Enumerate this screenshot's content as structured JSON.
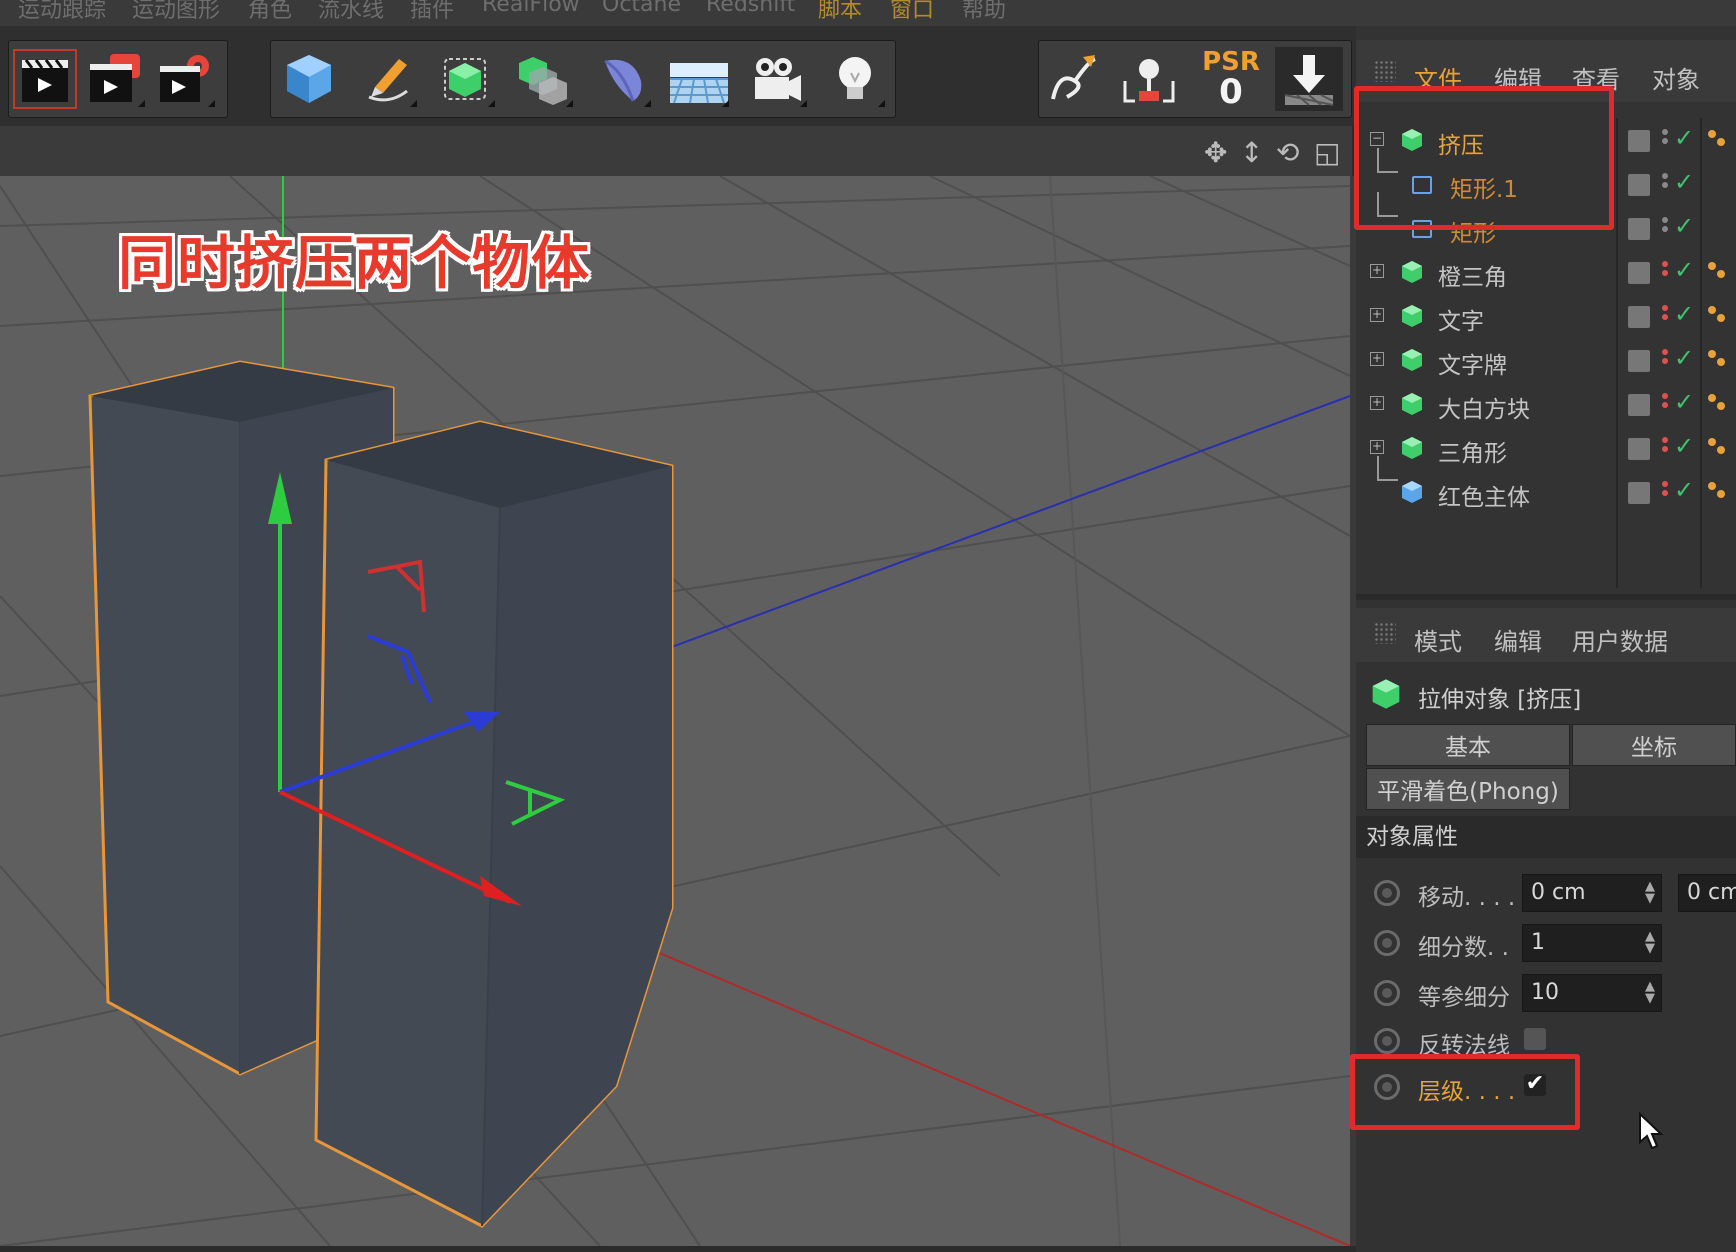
{
  "menubar": {
    "items": [
      {
        "label": "运动跟踪",
        "highlight": false
      },
      {
        "label": "运动图形",
        "highlight": false
      },
      {
        "label": "角色",
        "highlight": false
      },
      {
        "label": "流水线",
        "highlight": false
      },
      {
        "label": "插件",
        "highlight": false
      },
      {
        "label": "RealFlow",
        "highlight": false
      },
      {
        "label": "Octane",
        "highlight": false
      },
      {
        "label": "Redshift",
        "highlight": false
      },
      {
        "label": "脚本",
        "highlight": true
      },
      {
        "label": "窗口",
        "highlight": true
      },
      {
        "label": "帮助",
        "highlight": false
      }
    ]
  },
  "toolbar": {
    "render_group": [
      "render-view-icon",
      "render-picture-viewer-icon",
      "render-settings-icon"
    ],
    "create_group": [
      "cube-icon",
      "pen-icon",
      "subdivision-surface-icon",
      "array-icon",
      "deformer-icon",
      "floor-icon",
      "camera-icon",
      "light-icon"
    ],
    "right_group": {
      "psr_label": "PSR",
      "psr_value": "0"
    }
  },
  "viewport": {
    "overlay_title": "同时挤压两个物体",
    "colors": {
      "background": "#5f5f5f",
      "grid": "#4e4e4e",
      "object_fill": "#454c56",
      "selection_outline": "#e8963a",
      "axis_x": "#e02020",
      "axis_y": "#2ecc40",
      "axis_z": "#2a3bd6"
    }
  },
  "object_manager": {
    "menu": [
      "文件",
      "编辑",
      "查看",
      "对象"
    ],
    "objects": [
      {
        "name": "挤压",
        "type": "extrude",
        "level": 0,
        "expanded": true,
        "selected": true,
        "tags": true
      },
      {
        "name": "矩形.1",
        "type": "spline",
        "level": 1,
        "selected": true,
        "tags": false
      },
      {
        "name": "矩形",
        "type": "spline",
        "level": 1,
        "selected": true,
        "tags": false
      },
      {
        "name": "橙三角",
        "type": "extrude",
        "level": 0,
        "expanded": false,
        "tags": true
      },
      {
        "name": "文字",
        "type": "extrude",
        "level": 0,
        "expanded": false,
        "tags": true
      },
      {
        "name": "文字牌",
        "type": "extrude",
        "level": 0,
        "expanded": false,
        "tags": true
      },
      {
        "name": "大白方块",
        "type": "extrude",
        "level": 0,
        "expanded": false,
        "tags": true
      },
      {
        "name": "三角形",
        "type": "extrude",
        "level": 0,
        "expanded": false,
        "tags": true
      },
      {
        "name": "红色主体",
        "type": "cube",
        "level": 0,
        "expanded": false,
        "tags": true
      }
    ]
  },
  "attribute_manager": {
    "menu": [
      "模式",
      "编辑",
      "用户数据"
    ],
    "object_title": "拉伸对象 [挤压]",
    "tabs": [
      "基本",
      "坐标",
      "平滑着色(Phong)"
    ],
    "section": "对象属性",
    "params": {
      "move_label": "移动. . . .",
      "move_value": "0 cm",
      "move_value2": "0 cm",
      "subdiv_label": "细分数. .",
      "subdiv_value": "1",
      "iso_label": "等参细分",
      "iso_value": "10",
      "flip_label": "反转法线",
      "hierarchy_label": "层级. . . .",
      "hierarchy_checked": true
    }
  }
}
